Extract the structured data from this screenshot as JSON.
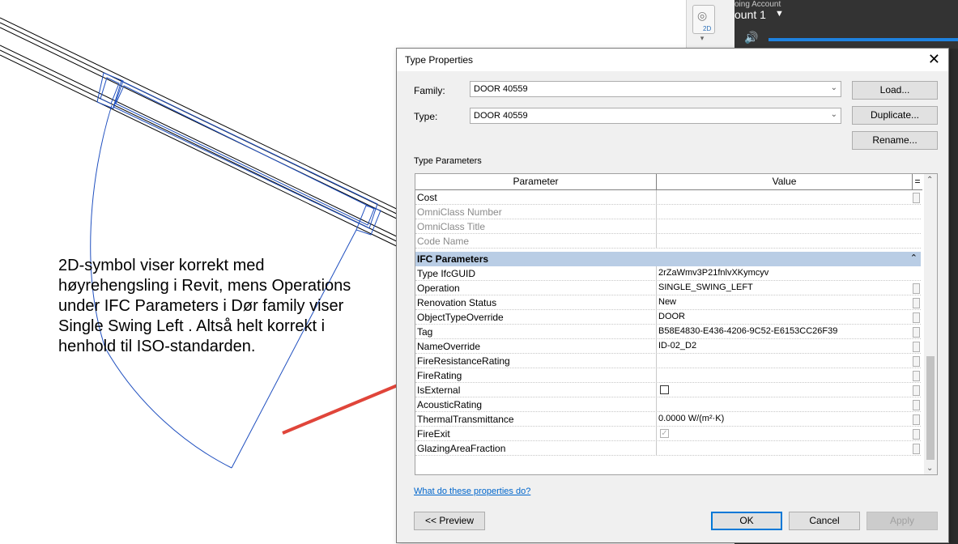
{
  "annotation": {
    "text": "2D-symbol viser korrekt med høyrehengsling i Revit, mens Operations under IFC Parameters i Dør family viser Single Swing Left . Altså helt korrekt i henhold til ISO-standarden."
  },
  "top_right": {
    "nav_2d_label": "2D",
    "account_label": "oing Account",
    "account_name": "ount 1"
  },
  "dialog": {
    "title": "Type Properties",
    "family_label": "Family:",
    "family_value": "DOOR 40559",
    "type_label": "Type:",
    "type_value": "DOOR 40559",
    "load_button": "Load...",
    "duplicate_button": "Duplicate...",
    "rename_button": "Rename...",
    "section_label": "Type Parameters",
    "grid_headers": {
      "parameter": "Parameter",
      "value": "Value",
      "sort": "="
    },
    "rows_top": [
      {
        "name": "Cost",
        "value": "",
        "greyed": false
      },
      {
        "name": "OmniClass Number",
        "value": "",
        "greyed": true
      },
      {
        "name": "OmniClass Title",
        "value": "",
        "greyed": true
      },
      {
        "name": "Code Name",
        "value": "",
        "greyed": true
      }
    ],
    "group_title": "IFC Parameters",
    "rows_ifc": [
      {
        "name": "Type IfcGUID",
        "value": "2rZaWmv3P21fnlvXKymcyv"
      },
      {
        "name": "Operation",
        "value": "SINGLE_SWING_LEFT"
      },
      {
        "name": "Renovation Status",
        "value": "New"
      },
      {
        "name": "ObjectTypeOverride",
        "value": "DOOR"
      },
      {
        "name": "Tag",
        "value": "B58E4830-E436-4206-9C52-E6153CC26F39"
      },
      {
        "name": "NameOverride",
        "value": "ID-02_D2"
      },
      {
        "name": "FireResistanceRating",
        "value": ""
      },
      {
        "name": "FireRating",
        "value": ""
      },
      {
        "name": "IsExternal",
        "value": "",
        "checkbox": "unchecked"
      },
      {
        "name": "AcousticRating",
        "value": ""
      },
      {
        "name": "ThermalTransmittance",
        "value": "0.0000 W/(m²·K)"
      },
      {
        "name": "FireExit",
        "value": "",
        "checkbox": "checked"
      },
      {
        "name": "GlazingAreaFraction",
        "value": ""
      }
    ],
    "help_link": "What do these properties do?",
    "preview_button": "<< Preview",
    "ok_button": "OK",
    "cancel_button": "Cancel",
    "apply_button": "Apply"
  },
  "colors": {
    "drawing_lines": "#1f4fbf",
    "arrow": "#e0453a",
    "group_header": "#b9cde5",
    "account_bg": "#333333",
    "volume_bar": "#1e82e0"
  }
}
